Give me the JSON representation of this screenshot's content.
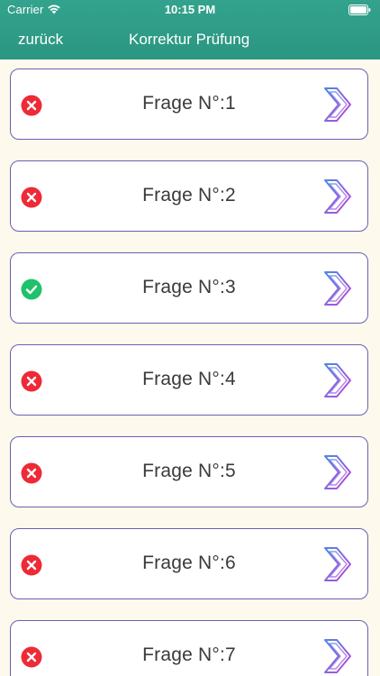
{
  "status_bar": {
    "carrier": "Carrier",
    "time": "10:15 PM"
  },
  "nav": {
    "back_label": "zurück",
    "title": "Korrektur Prüfung"
  },
  "colors": {
    "header": "#2e9a85",
    "background": "#fdf9ec",
    "card_border": "#6e5fb2",
    "wrong": "#ee2a37",
    "correct": "#1fc16b"
  },
  "questions": [
    {
      "label": "Frage N°:1",
      "status": "wrong",
      "icon": "x-circle-icon"
    },
    {
      "label": "Frage N°:2",
      "status": "wrong",
      "icon": "x-circle-icon"
    },
    {
      "label": "Frage N°:3",
      "status": "correct",
      "icon": "check-circle-icon"
    },
    {
      "label": "Frage N°:4",
      "status": "wrong",
      "icon": "x-circle-icon"
    },
    {
      "label": "Frage N°:5",
      "status": "wrong",
      "icon": "x-circle-icon"
    },
    {
      "label": "Frage N°:6",
      "status": "wrong",
      "icon": "x-circle-icon"
    },
    {
      "label": "Frage N°:7",
      "status": "wrong",
      "icon": "x-circle-icon"
    }
  ]
}
